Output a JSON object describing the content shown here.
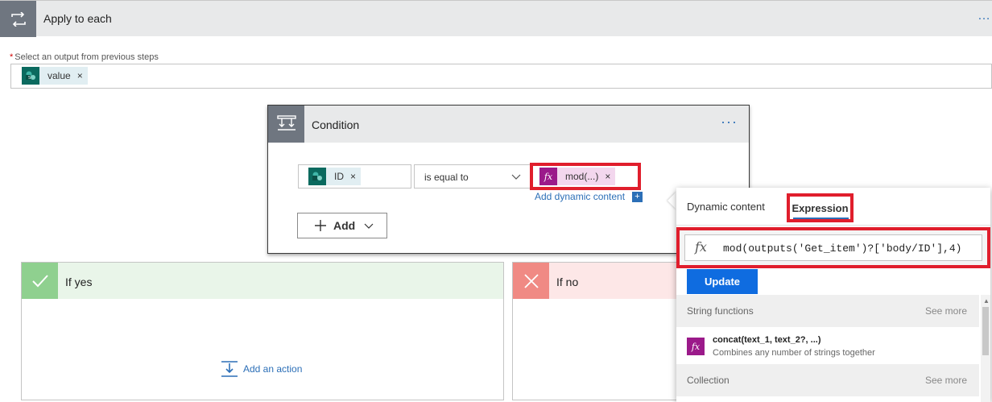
{
  "apply_each": {
    "title": "Apply to each",
    "field_required_mark": "*",
    "field_label": "Select an output from previous steps",
    "token_label": "value",
    "token_remove": "×",
    "more": "…"
  },
  "condition": {
    "title": "Condition",
    "more": "···",
    "left_token": "ID",
    "left_remove": "×",
    "operator": "is equal to",
    "right_token": "mod(...)",
    "right_remove": "×",
    "add_dynamic": "Add dynamic content",
    "add_dynamic_plus": "+",
    "add_button": "Add"
  },
  "branches": {
    "yes_title": "If yes",
    "add_action": "Add an action",
    "no_title": "If no"
  },
  "popup": {
    "tab_dynamic": "Dynamic content",
    "tab_expression": "Expression",
    "expression_value": "mod(outputs('Get_item')?['body/ID'],4)",
    "update_button": "Update",
    "section1_title": "String functions",
    "section1_more": "See more",
    "function_name": "concat(text_1, text_2?, ...)",
    "function_desc": "Combines any number of strings together",
    "section2_title": "Collection",
    "section2_more": "See more"
  },
  "colors": {
    "accent": "#2c6fb7",
    "highlight": "#e01e2c",
    "sharepoint": "#0b6a5f",
    "expression": "#9b1a8a",
    "yes": "#8fd08f",
    "no": "#f08a84",
    "update": "#0f6ce0"
  }
}
